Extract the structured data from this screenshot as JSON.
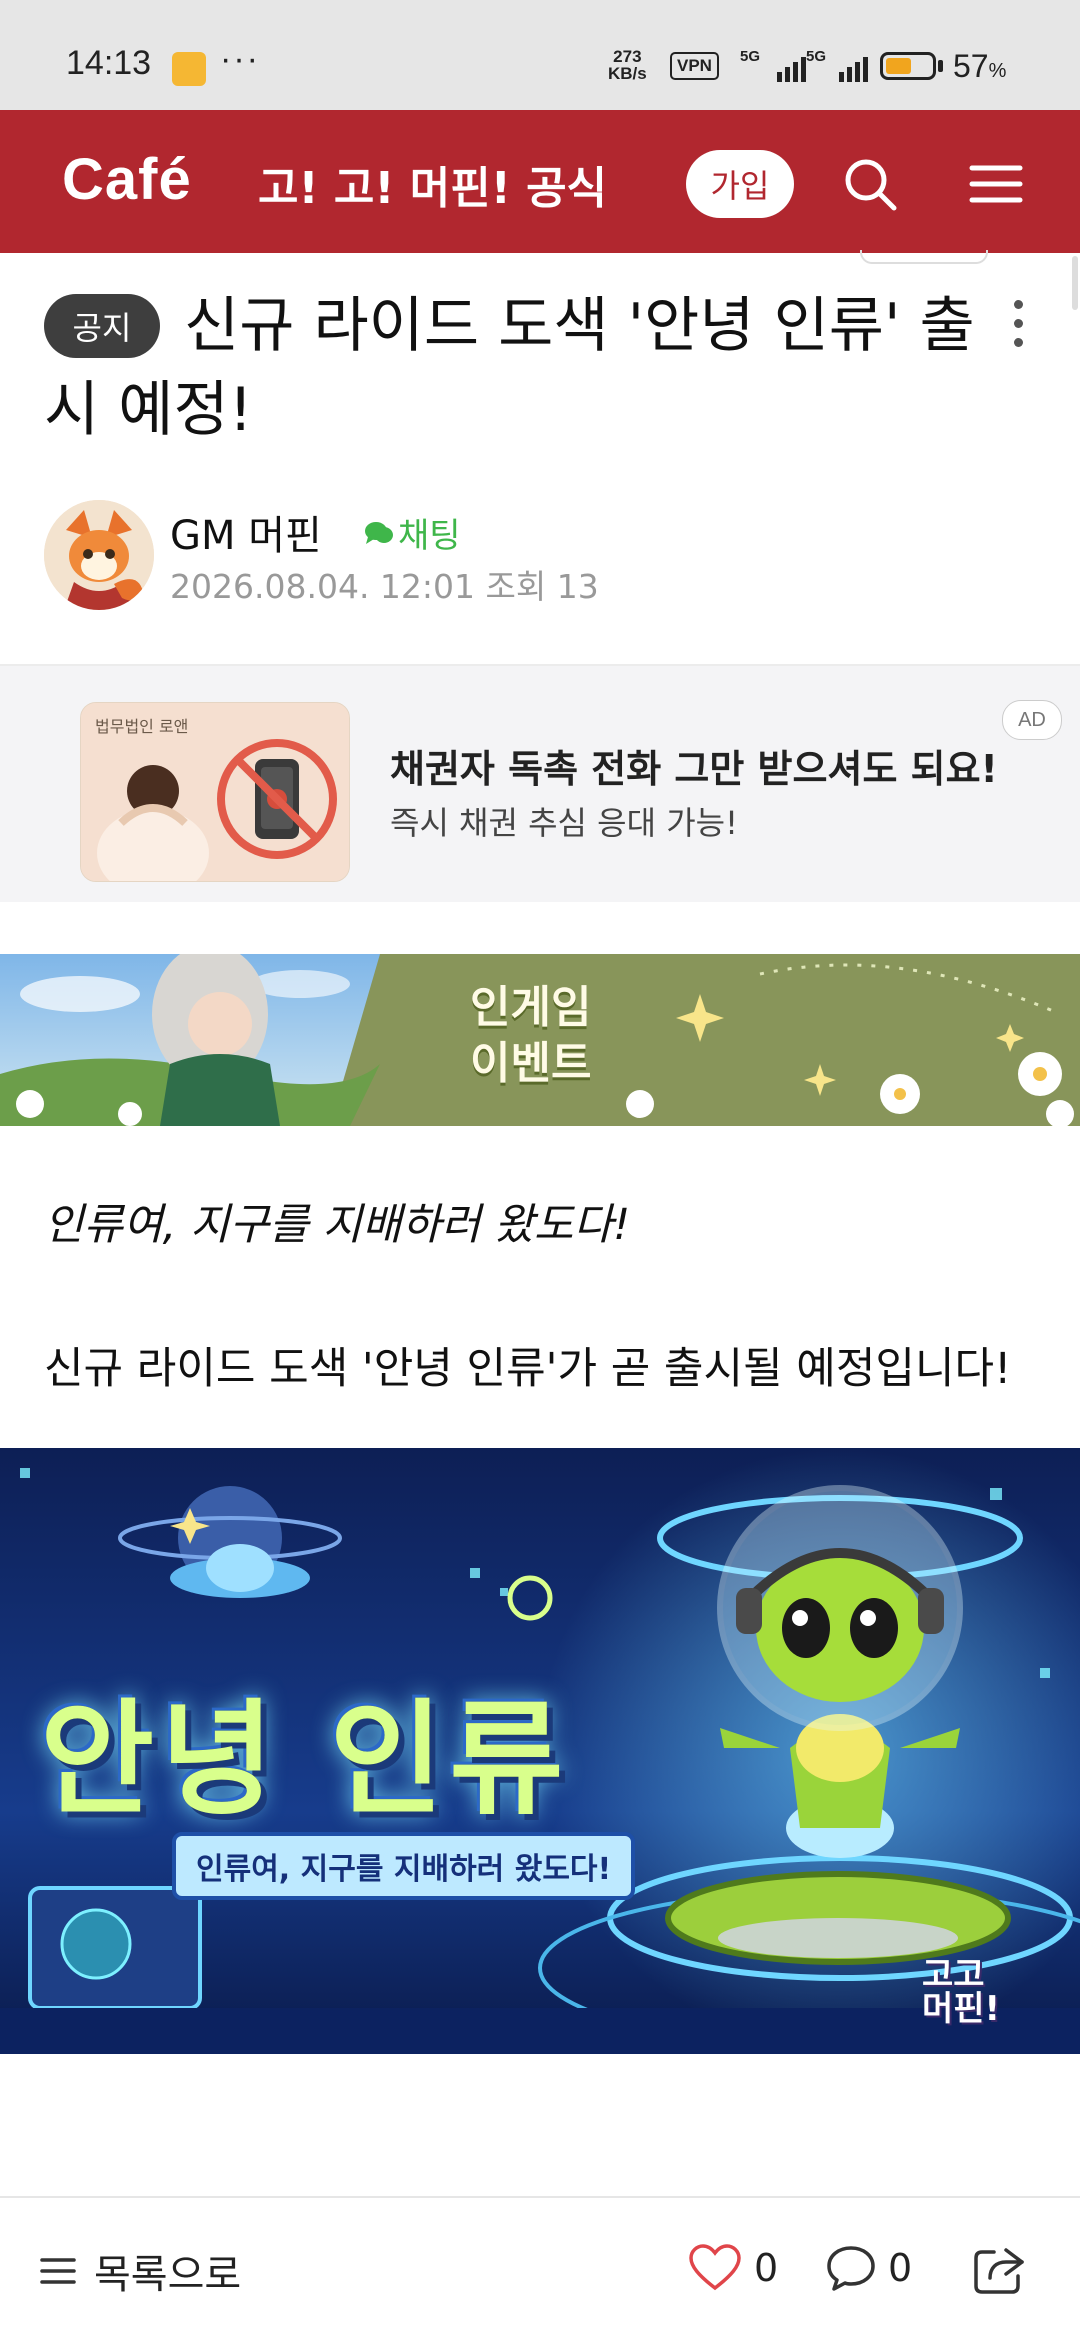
{
  "status_bar": {
    "time": "14:13",
    "more": "···",
    "net_speed_value": "273",
    "net_speed_unit": "KB/s",
    "vpn": "VPN",
    "signal1": "5G",
    "signal2": "5G",
    "battery": "57",
    "battery_unit": "%",
    "battery_level": 0.57
  },
  "header": {
    "logo": "Café",
    "cafe_name": "고! 고! 머핀! 공식",
    "join_label": "가입",
    "bg_color": "#b1272f"
  },
  "article": {
    "badge": "공지",
    "title": "신규 라이드 도색 '안녕 인류' 출시 예정!",
    "author": "GM 머핀",
    "chat_label": "채팅",
    "meta": "2026.08.04. 12:01  조회 13"
  },
  "ad": {
    "image_label": "법무법인 로앤",
    "headline": "채권자 독촉 전화 그만 받으셔도 되요!",
    "subline": "즉시 채권 추심 응대 가능!",
    "badge": "AD"
  },
  "event_banner": {
    "line1": "인게임",
    "line2": "이벤트"
  },
  "content": {
    "italic_line": "인류여, 지구를 지배하러 왔도다!",
    "body_line": "신규 라이드 도색 '안녕 인류'가 곧 출시될 예정입니다!"
  },
  "main_banner": {
    "title": "안녕 인류",
    "subtitle": "인류여, 지구를 지배하러 왔도다!",
    "mark_line1": "고고",
    "mark_line2": "머핀!"
  },
  "bottom_bar": {
    "list_label": "목록으로",
    "like_count": "0",
    "comment_count": "0"
  }
}
